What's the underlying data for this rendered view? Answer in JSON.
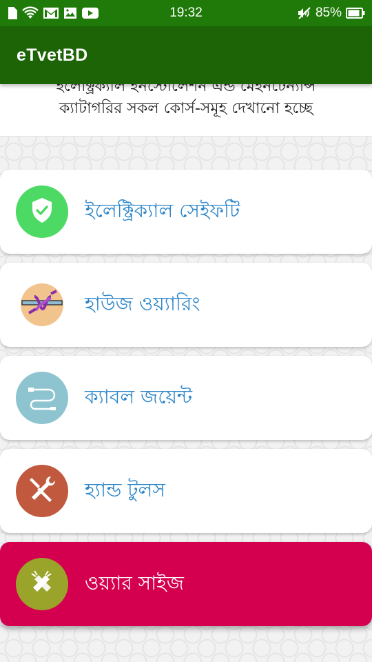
{
  "status_bar": {
    "time": "19:32",
    "battery": "85%"
  },
  "app_bar": {
    "title": "eTvetBD"
  },
  "header": {
    "line1": "ইলেক্ট্রিক্যাল ইনস্টোলেশন এন্ড মেইনটেন্যান্স",
    "line2": "ক্যাটাগরির সকল কোর্স-সমূহ দেখানো হচ্ছে"
  },
  "courses": [
    {
      "label": "ইলেক্ট্রিক্যাল সেইফটি",
      "icon": "shield-check-icon",
      "icon_bg": "#4cd964",
      "active": false
    },
    {
      "label": "হাউজ ওয়্যারিং",
      "icon": "wire-knot-icon",
      "icon_bg": "#f2c48d",
      "active": false
    },
    {
      "label": "ক্যাবল জয়েন্ট",
      "icon": "cable-icon",
      "icon_bg": "#8ec4d0",
      "active": false
    },
    {
      "label": "হ্যান্ড টুলস",
      "icon": "tools-icon",
      "icon_bg": "#c0593e",
      "active": false
    },
    {
      "label": "ওয়্যার সাইজ",
      "icon": "wire-size-icon",
      "icon_bg": "#9aa32a",
      "active": true
    }
  ],
  "colors": {
    "status_bar": "#1f7a0a",
    "app_bar": "#1c6406",
    "label": "#2d86c9",
    "active_card": "#d4004f"
  }
}
